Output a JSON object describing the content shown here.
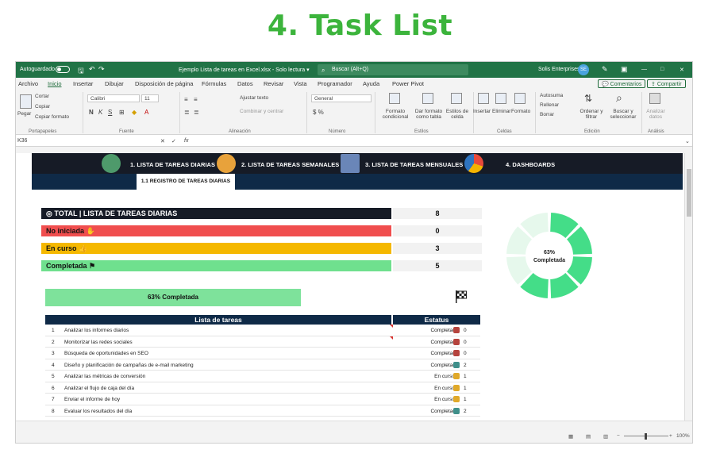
{
  "headline": "4. Task List",
  "titlebar": {
    "autosave": "Autoguardado",
    "doc": "Ejemplo Lista de tareas en Excel.xlsx  -  Solo lectura  ▾",
    "search": "Buscar (Alt+Q)",
    "user": "Solis Enterprises",
    "initials": "SE",
    "minimize": "—",
    "restore": "□",
    "close": "✕"
  },
  "menu": {
    "items": [
      "Archivo",
      "Inicio",
      "Insertar",
      "Dibujar",
      "Disposición de página",
      "Fórmulas",
      "Datos",
      "Revisar",
      "Vista",
      "Programador",
      "Ayuda",
      "Power Pivot"
    ],
    "comments": "Comentarios",
    "share": "Compartir"
  },
  "ribbon": {
    "cut": "Cortar",
    "copy": "Copiar",
    "paste": "Pegar",
    "format_painter": "Copiar formato",
    "clipboard": "Portapapeles",
    "font_name": "Calibri",
    "font_size": "11",
    "font_group": "Fuente",
    "wrap": "Ajustar texto",
    "merge": "Combinar y centrar",
    "alignment": "Alineación",
    "number_format": "General",
    "number_group": "Número",
    "cond_format": "Formato condicional",
    "table_format": "Dar formato como tabla",
    "cell_styles": "Estilos de celda",
    "styles_group": "Estilos",
    "insert": "Insertar",
    "delete": "Eliminar",
    "format": "Formato",
    "cells_group": "Celdas",
    "autosum": "Autosuma",
    "fill": "Rellenar",
    "clear": "Borrar",
    "sort_filter": "Ordenar y filtrar",
    "find_select": "Buscar y seleccionar",
    "editing_group": "Edición",
    "analyze": "Analizar datos",
    "analysis_group": "Análisis"
  },
  "formula": {
    "cell": "K36",
    "fx": "fx"
  },
  "nav": {
    "tabs": [
      "1. LISTA DE TAREAS DIARIAS",
      "2. LISTA DE TAREAS SEMANALES",
      "3. LISTA DE TAREAS MENSUALES",
      "4. DASHBOARDS"
    ],
    "subtab": "1.1 REGISTRO DE TAREAS DIARIAS"
  },
  "kpis": {
    "total_label": "TOTAL | LISTA DE TAREAS DIARIAS",
    "total": "8",
    "not_started_label": "No iniciada",
    "not_started": "0",
    "in_progress_label": "En curso",
    "in_progress": "3",
    "done_label": "Completada",
    "done": "5"
  },
  "donut": {
    "pct": "63%",
    "label": "Completada",
    "fraction": 0.63,
    "segments": 8,
    "color": "#44dd88"
  },
  "progress": {
    "label": "63% Completada",
    "fraction": 0.63
  },
  "table": {
    "headers": [
      "Lista de tareas",
      "Estatus"
    ],
    "rows": [
      {
        "n": "1",
        "task": "Analizar los informes diarios",
        "status": "Completada",
        "count": "0",
        "color": "#b5433d"
      },
      {
        "n": "2",
        "task": "Monitorizar las redes sociales",
        "status": "Completada",
        "count": "0",
        "color": "#b5433d"
      },
      {
        "n": "3",
        "task": "Búsqueda de oportunidades en SEO",
        "status": "Completada",
        "count": "0",
        "color": "#b5433d"
      },
      {
        "n": "4",
        "task": "Diseño y planificación de campañas de e-mail marketing",
        "status": "Completada",
        "count": "2",
        "color": "#3f8f8a"
      },
      {
        "n": "5",
        "task": "Analizar las métricas de conversión",
        "status": "En curso",
        "count": "1",
        "color": "#e0a92a"
      },
      {
        "n": "6",
        "task": "Analizar el flujo de caja del día",
        "status": "En curso",
        "count": "1",
        "color": "#e0a92a"
      },
      {
        "n": "7",
        "task": "Enviar el informe de hoy",
        "status": "En curso",
        "count": "1",
        "color": "#e0a92a"
      },
      {
        "n": "8",
        "task": "Evaluar los resultados del día",
        "status": "Completada",
        "count": "2",
        "color": "#3f8f8a"
      }
    ]
  },
  "status": {
    "zoom": "100%",
    "zoom_minus": "−",
    "zoom_plus": "+"
  }
}
